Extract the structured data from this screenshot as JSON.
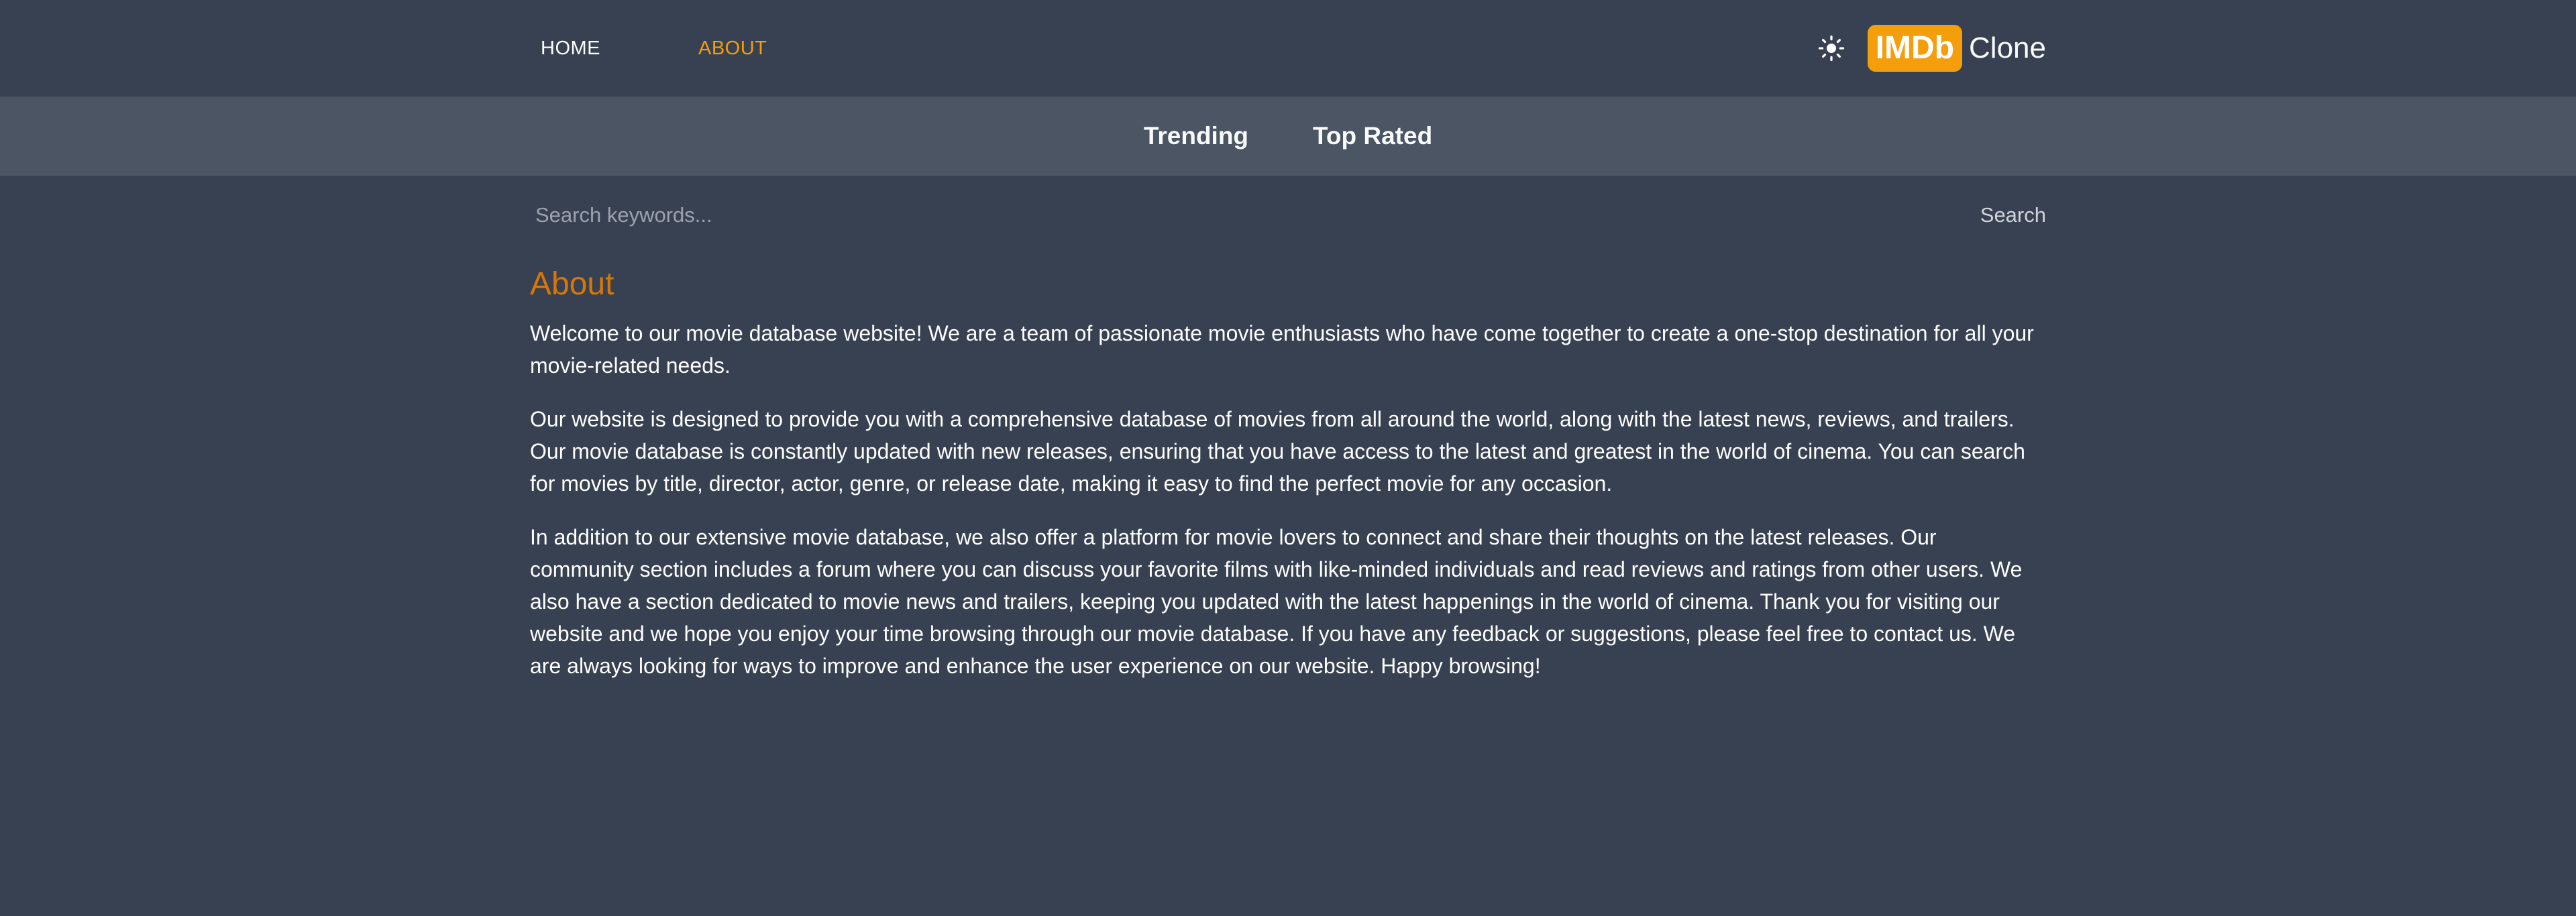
{
  "nav": {
    "home_label": "HOME",
    "about_label": "ABOUT"
  },
  "header": {
    "theme_icon": "sun-icon",
    "logo_badge": "IMDb",
    "logo_text": "Clone"
  },
  "tabs": [
    {
      "label": "Trending"
    },
    {
      "label": "Top Rated"
    }
  ],
  "search": {
    "placeholder": "Search keywords...",
    "button_label": "Search"
  },
  "about": {
    "title": "About",
    "paragraphs": [
      "Welcome to our movie database website! We are a team of passionate movie enthusiasts who have come together to create a one-stop destination for all your movie-related needs.",
      "Our website is designed to provide you with a comprehensive database of movies from all around the world, along with the latest news, reviews, and trailers. Our movie database is constantly updated with new releases, ensuring that you have access to the latest and greatest in the world of cinema. You can search for movies by title, director, actor, genre, or release date, making it easy to find the perfect movie for any occasion.",
      "In addition to our extensive movie database, we also offer a platform for movie lovers to connect and share their thoughts on the latest releases. Our community section includes a forum where you can discuss your favorite films with like-minded individuals and read reviews and ratings from other users. We also have a section dedicated to movie news and trailers, keeping you updated with the latest happenings in the world of cinema. Thank you for visiting our website and we hope you enjoy your time browsing through our movie database. If you have any feedback or suggestions, please feel free to contact us. We are always looking for ways to improve and enhance the user experience on our website. Happy browsing!"
    ]
  },
  "colors": {
    "background": "#374151",
    "tabs_bar": "#4b5563",
    "accent": "#f59e0b",
    "title": "#d97706"
  }
}
